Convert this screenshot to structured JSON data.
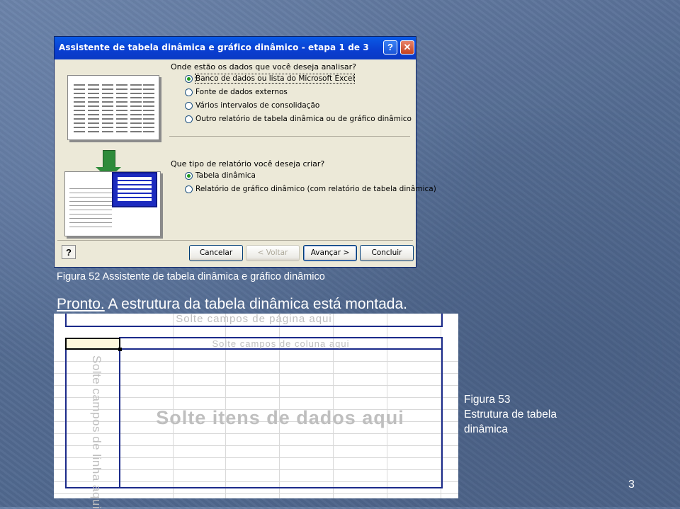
{
  "dialog": {
    "title": "Assistente de tabela dinâmica e gráfico dinâmico - etapa 1 de 3",
    "help_glyph": "?",
    "close_glyph": "✕",
    "question1": "Onde estão os dados que você deseja analisar?",
    "source_options": [
      {
        "label": "Banco de dados ou lista do Microsoft Excel",
        "selected": true
      },
      {
        "label": "Fonte de dados externos",
        "selected": false
      },
      {
        "label": "Vários intervalos de consolidação",
        "selected": false
      },
      {
        "label": "Outro relatório de tabela dinâmica ou de gráfico dinâmico",
        "selected": false
      }
    ],
    "question2": "Que tipo de relatório você deseja criar?",
    "report_options": [
      {
        "label": "Tabela dinâmica",
        "selected": true
      },
      {
        "label": "Relatório de gráfico dinâmico (com relatório de tabela dinâmica)",
        "selected": false
      }
    ],
    "buttons": {
      "help": "?",
      "cancel": "Cancelar",
      "back": "< Voltar",
      "next": "Avançar >",
      "finish": "Concluir"
    }
  },
  "caption_fig52": "Figura 52 Assistente de tabela dinâmica e gráfico dinâmico",
  "ready_text_link": "Pronto.",
  "ready_text_rest": " A estrutura da tabela dinâmica está montada.",
  "pivot": {
    "page_zone": "Solte campos de página aqui",
    "column_zone": "Solte campos de coluna aqui",
    "row_zone": "Solte campos de linha aqui",
    "data_zone": "Solte itens de dados aqui"
  },
  "caption_fig53": [
    "Figura 53",
    "Estrutura de tabela",
    "dinâmica"
  ],
  "page_number": "3",
  "colors": {
    "background": "#5a7196",
    "titlebar": "#0a3ed0",
    "zone_border": "#1b2a8a",
    "radio_dot": "#1f9a1f"
  }
}
